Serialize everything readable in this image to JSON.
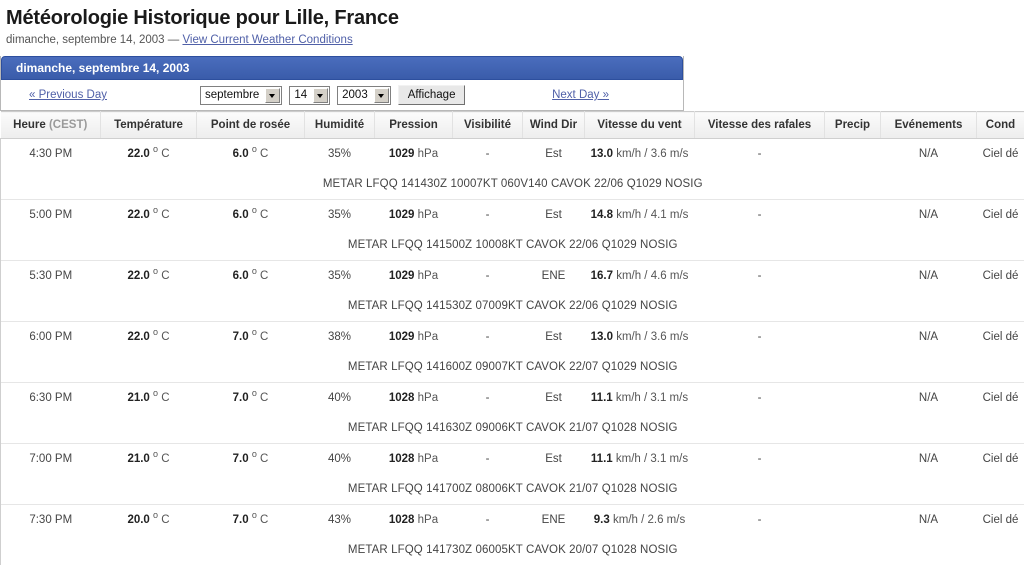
{
  "header": {
    "title": "Météorologie Historique pour Lille, France",
    "date_text": "dimanche, septembre 14, 2003",
    "separator": "—",
    "current_conditions_link": "View Current Weather Conditions"
  },
  "day_panel": {
    "bar_title": "dimanche, septembre 14, 2003",
    "bar_color": "#3f63b4",
    "prev_day_label": "« Previous Day",
    "next_day_label": "Next Day »",
    "month_select": "septembre",
    "day_select": "14",
    "year_select": "2003",
    "view_button_label": "Affichage"
  },
  "table": {
    "columns": [
      {
        "label": "Heure",
        "muted": " (CEST)"
      },
      {
        "label": "Température",
        "muted": ""
      },
      {
        "label": "Point de rosée",
        "muted": ""
      },
      {
        "label": "Humidité",
        "muted": ""
      },
      {
        "label": "Pression",
        "muted": ""
      },
      {
        "label": "Visibilité",
        "muted": ""
      },
      {
        "label": "Wind Dir",
        "muted": ""
      },
      {
        "label": "Vitesse du vent",
        "muted": ""
      },
      {
        "label": "Vitesse des rafales",
        "muted": ""
      },
      {
        "label": "Precip",
        "muted": ""
      },
      {
        "label": "Evénements",
        "muted": ""
      },
      {
        "label": "Cond",
        "muted": ""
      }
    ],
    "rows": [
      {
        "time": "4:30 PM",
        "temp_value": "22.0",
        "temp_unit": "C",
        "dew_value": "6.0",
        "dew_unit": "C",
        "humidity": "35%",
        "pressure_value": "1029",
        "pressure_unit": "hPa",
        "visibility": "-",
        "wind_dir": "Est",
        "wind_speed_value": "13.0",
        "wind_speed_unit": "km/h / 3.6 m/s",
        "gust": "-",
        "precip": "",
        "events": "N/A",
        "conditions": "Ciel dé",
        "metar": "METAR LFQQ 141430Z 10007KT 060V140 CAVOK 22/06 Q1029 NOSIG"
      },
      {
        "time": "5:00 PM",
        "temp_value": "22.0",
        "temp_unit": "C",
        "dew_value": "6.0",
        "dew_unit": "C",
        "humidity": "35%",
        "pressure_value": "1029",
        "pressure_unit": "hPa",
        "visibility": "-",
        "wind_dir": "Est",
        "wind_speed_value": "14.8",
        "wind_speed_unit": "km/h / 4.1 m/s",
        "gust": "-",
        "precip": "",
        "events": "N/A",
        "conditions": "Ciel dé",
        "metar": "METAR LFQQ 141500Z 10008KT CAVOK 22/06 Q1029 NOSIG"
      },
      {
        "time": "5:30 PM",
        "temp_value": "22.0",
        "temp_unit": "C",
        "dew_value": "6.0",
        "dew_unit": "C",
        "humidity": "35%",
        "pressure_value": "1029",
        "pressure_unit": "hPa",
        "visibility": "-",
        "wind_dir": "ENE",
        "wind_speed_value": "16.7",
        "wind_speed_unit": "km/h / 4.6 m/s",
        "gust": "-",
        "precip": "",
        "events": "N/A",
        "conditions": "Ciel dé",
        "metar": "METAR LFQQ 141530Z 07009KT CAVOK 22/06 Q1029 NOSIG"
      },
      {
        "time": "6:00 PM",
        "temp_value": "22.0",
        "temp_unit": "C",
        "dew_value": "7.0",
        "dew_unit": "C",
        "humidity": "38%",
        "pressure_value": "1029",
        "pressure_unit": "hPa",
        "visibility": "-",
        "wind_dir": "Est",
        "wind_speed_value": "13.0",
        "wind_speed_unit": "km/h / 3.6 m/s",
        "gust": "-",
        "precip": "",
        "events": "N/A",
        "conditions": "Ciel dé",
        "metar": "METAR LFQQ 141600Z 09007KT CAVOK 22/07 Q1029 NOSIG"
      },
      {
        "time": "6:30 PM",
        "temp_value": "21.0",
        "temp_unit": "C",
        "dew_value": "7.0",
        "dew_unit": "C",
        "humidity": "40%",
        "pressure_value": "1028",
        "pressure_unit": "hPa",
        "visibility": "-",
        "wind_dir": "Est",
        "wind_speed_value": "11.1",
        "wind_speed_unit": "km/h / 3.1 m/s",
        "gust": "-",
        "precip": "",
        "events": "N/A",
        "conditions": "Ciel dé",
        "metar": "METAR LFQQ 141630Z 09006KT CAVOK 21/07 Q1028 NOSIG"
      },
      {
        "time": "7:00 PM",
        "temp_value": "21.0",
        "temp_unit": "C",
        "dew_value": "7.0",
        "dew_unit": "C",
        "humidity": "40%",
        "pressure_value": "1028",
        "pressure_unit": "hPa",
        "visibility": "-",
        "wind_dir": "Est",
        "wind_speed_value": "11.1",
        "wind_speed_unit": "km/h / 3.1 m/s",
        "gust": "-",
        "precip": "",
        "events": "N/A",
        "conditions": "Ciel dé",
        "metar": "METAR LFQQ 141700Z 08006KT CAVOK 21/07 Q1028 NOSIG"
      },
      {
        "time": "7:30 PM",
        "temp_value": "20.0",
        "temp_unit": "C",
        "dew_value": "7.0",
        "dew_unit": "C",
        "humidity": "43%",
        "pressure_value": "1028",
        "pressure_unit": "hPa",
        "visibility": "-",
        "wind_dir": "ENE",
        "wind_speed_value": "9.3",
        "wind_speed_unit": "km/h / 2.6 m/s",
        "gust": "-",
        "precip": "",
        "events": "N/A",
        "conditions": "Ciel dé",
        "metar": "METAR LFQQ 141730Z 06005KT CAVOK 20/07 Q1028 NOSIG"
      }
    ]
  }
}
